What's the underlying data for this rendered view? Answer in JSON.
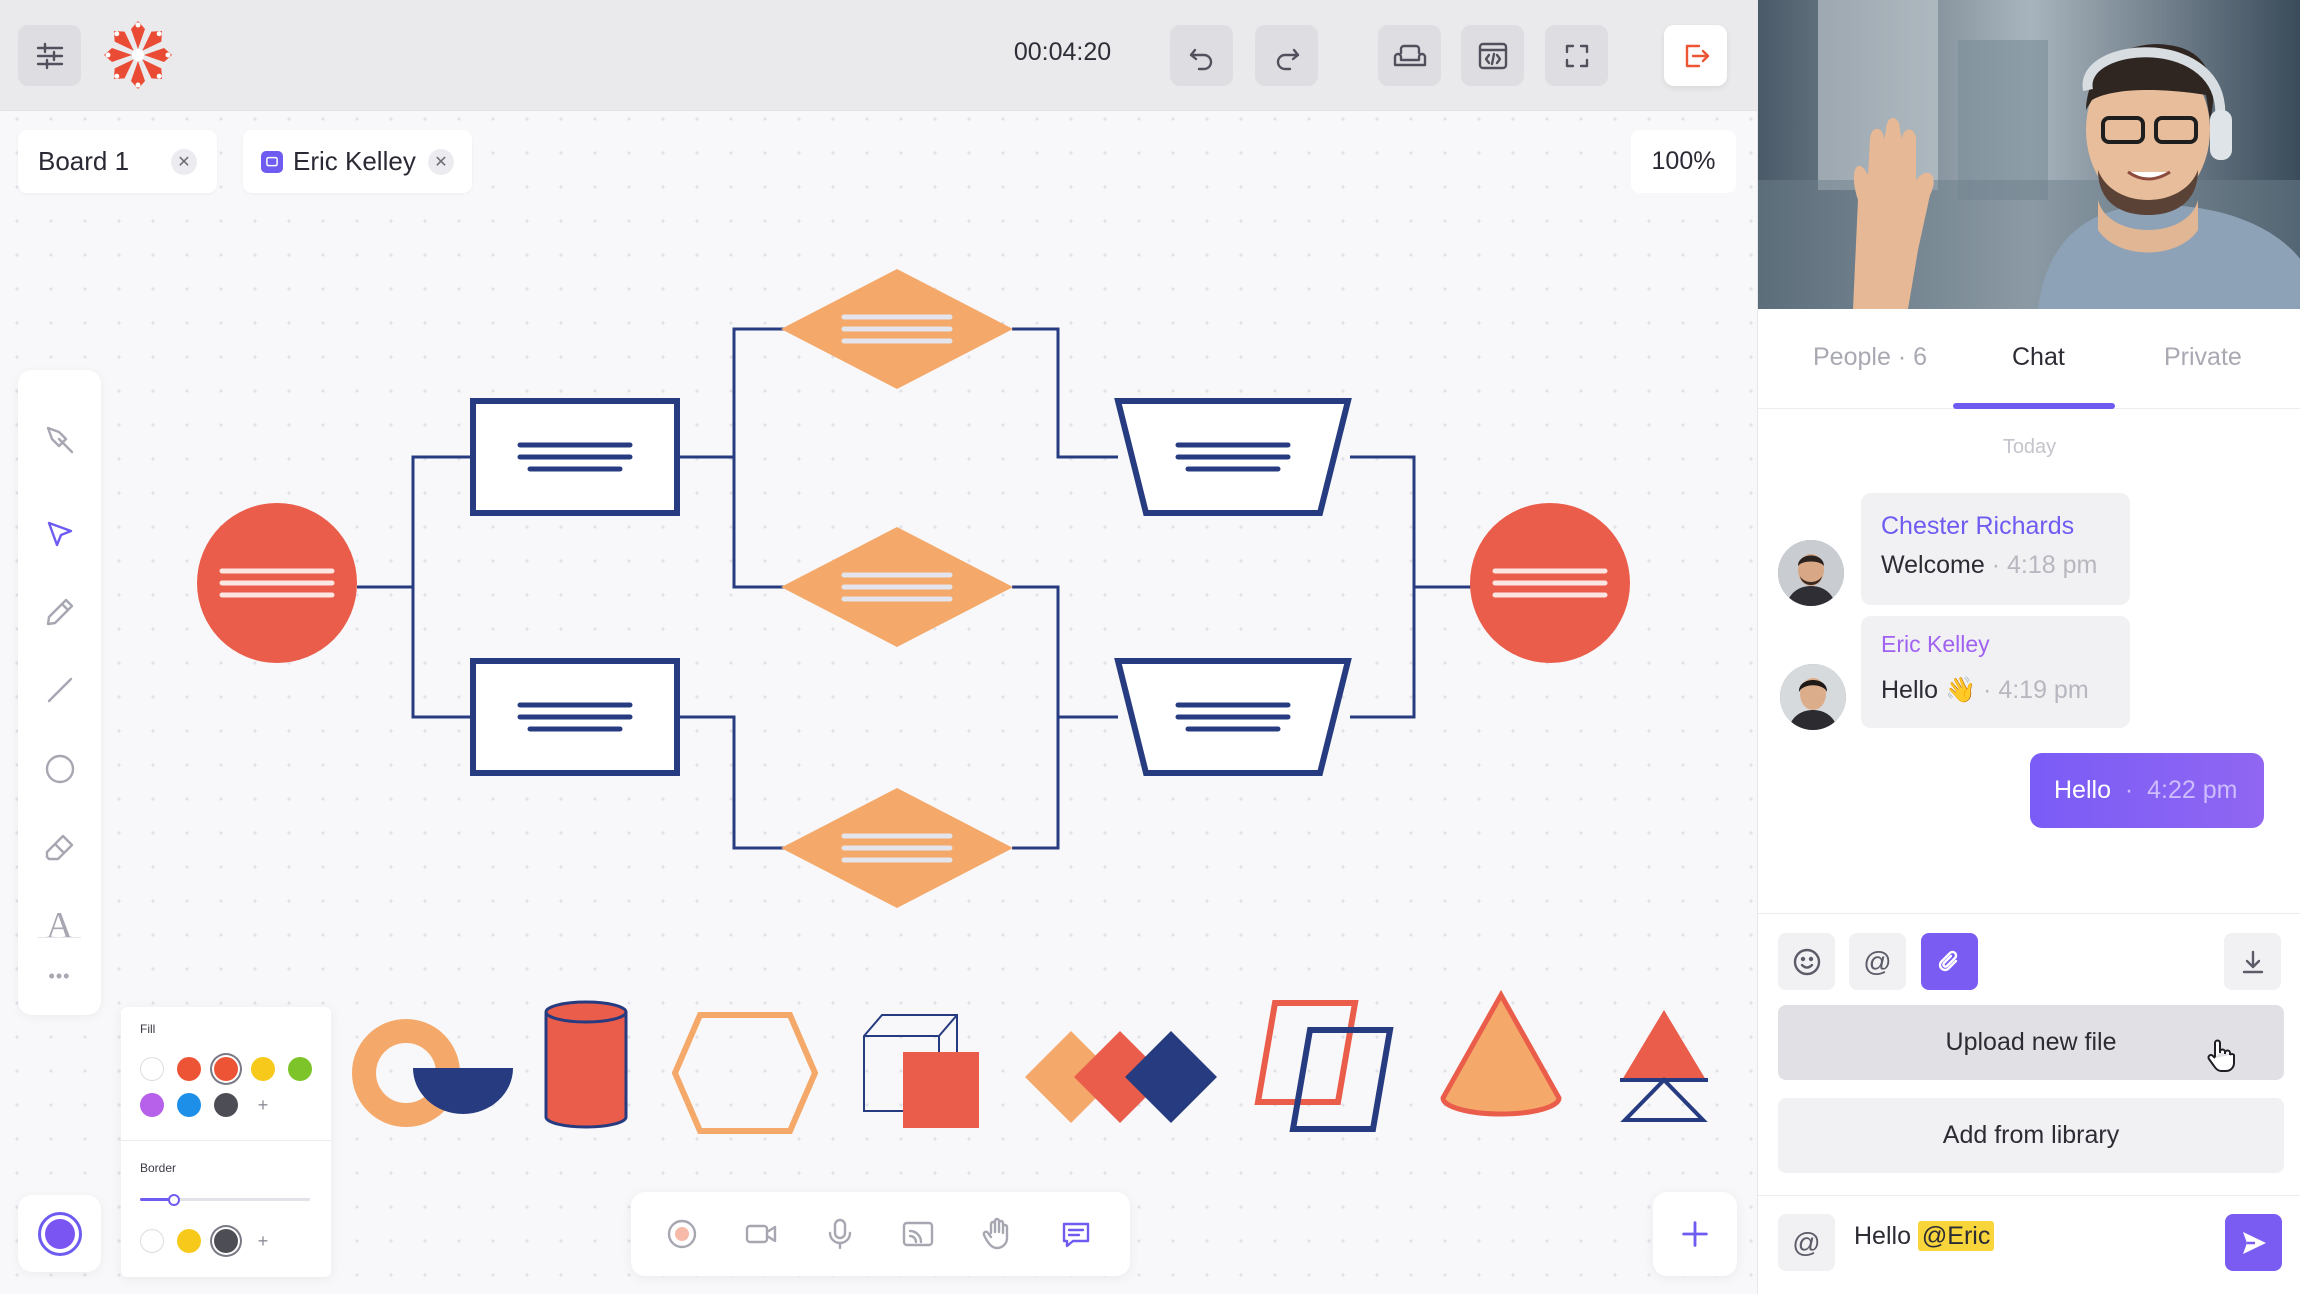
{
  "topbar": {
    "timer": "00:04:20",
    "buttons": [
      "settings-icon",
      "undo-icon",
      "redo-icon",
      "sofa-icon",
      "embed-code-icon",
      "fullscreen-icon",
      "exit-icon"
    ]
  },
  "tabs": [
    {
      "label": "Board 1"
    },
    {
      "label": "Eric Kelley"
    }
  ],
  "zoom": "100%",
  "toolbar": {
    "tools": [
      "pin-icon",
      "select-icon",
      "pencil-icon",
      "line-icon",
      "circle-icon",
      "eraser-icon",
      "text-icon",
      "more-icon"
    ],
    "text_tool_glyph": "A",
    "more_glyph": "•••",
    "active": "select-icon"
  },
  "style_panel": {
    "fill_label": "Fill",
    "border_label": "Border",
    "fill_colors": [
      "#ffffff",
      "#ec5435",
      "#ec5435",
      "#f7c91a",
      "#7dc42a",
      "#b760ea",
      "#1e8fe8",
      "#4d4d56"
    ],
    "border_colors": [
      "#ffffff",
      "#f7c91a",
      "#4d4d56"
    ],
    "border_width_fraction": 0.2,
    "plus": "+"
  },
  "media_bar": [
    "record-icon",
    "video-icon",
    "mic-icon",
    "cast-icon",
    "raise-hand-icon",
    "chat-icon"
  ],
  "colors": {
    "accent": "#6e5cf1",
    "diagram_navy": "#273b80",
    "diagram_orange": "#f4a96a",
    "diagram_red": "#ea5d4b"
  },
  "chat": {
    "tabs": [
      {
        "label": "People",
        "count": "6",
        "separator": "·"
      },
      {
        "label": "Chat",
        "active": true
      },
      {
        "label": "Private"
      }
    ],
    "day_label": "Today",
    "messages": [
      {
        "sender": "Chester Richards",
        "text": "Welcome",
        "time": "4:18 pm"
      },
      {
        "sender": "Eric Kelley",
        "text": "Hello",
        "emoji": "👋",
        "time": "4:19 pm"
      },
      {
        "sender": "me",
        "text": "Hello",
        "time": "4:22 pm"
      }
    ],
    "dot": "·",
    "actions": [
      "emoji-icon",
      "mention-icon",
      "attachment-icon",
      "download-icon"
    ],
    "mention_glyph": "@",
    "menu": {
      "upload": "Upload new file",
      "library": "Add from library"
    },
    "input": {
      "text": "Hello ",
      "mention": "@Eric"
    }
  }
}
